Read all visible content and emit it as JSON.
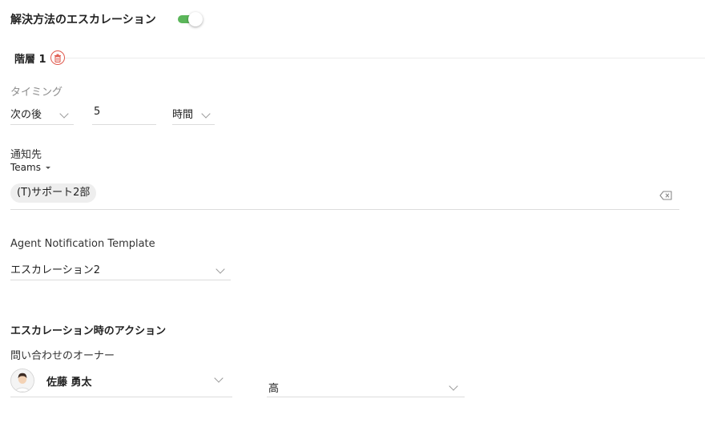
{
  "header": {
    "title": "解決方法のエスカレーション",
    "toggle_on": true,
    "toggle_color": "#5bb65a"
  },
  "tier": {
    "label": "階層 1"
  },
  "timing": {
    "label": "タイミング",
    "condition": "次の後",
    "amount": "5",
    "unit": "時間"
  },
  "notify": {
    "label": "通知先",
    "type": "Teams",
    "recipients": [
      "(T)サポート2部"
    ]
  },
  "template": {
    "label": "Agent Notification Template",
    "value": "エスカレーション2"
  },
  "actions": {
    "heading": "エスカレーション時のアクション",
    "owner_label": "問い合わせのオーナー",
    "owner_name": "佐藤 勇太",
    "priority": "高"
  },
  "colors": {
    "accent_green": "#5bb65a",
    "delete_red": "#e05a4e",
    "divider": "#dcdcdc"
  },
  "icons": [
    "toggle-switch",
    "trash-icon",
    "chevron-down-icon",
    "caret-down-icon",
    "clear-icon",
    "avatar"
  ]
}
